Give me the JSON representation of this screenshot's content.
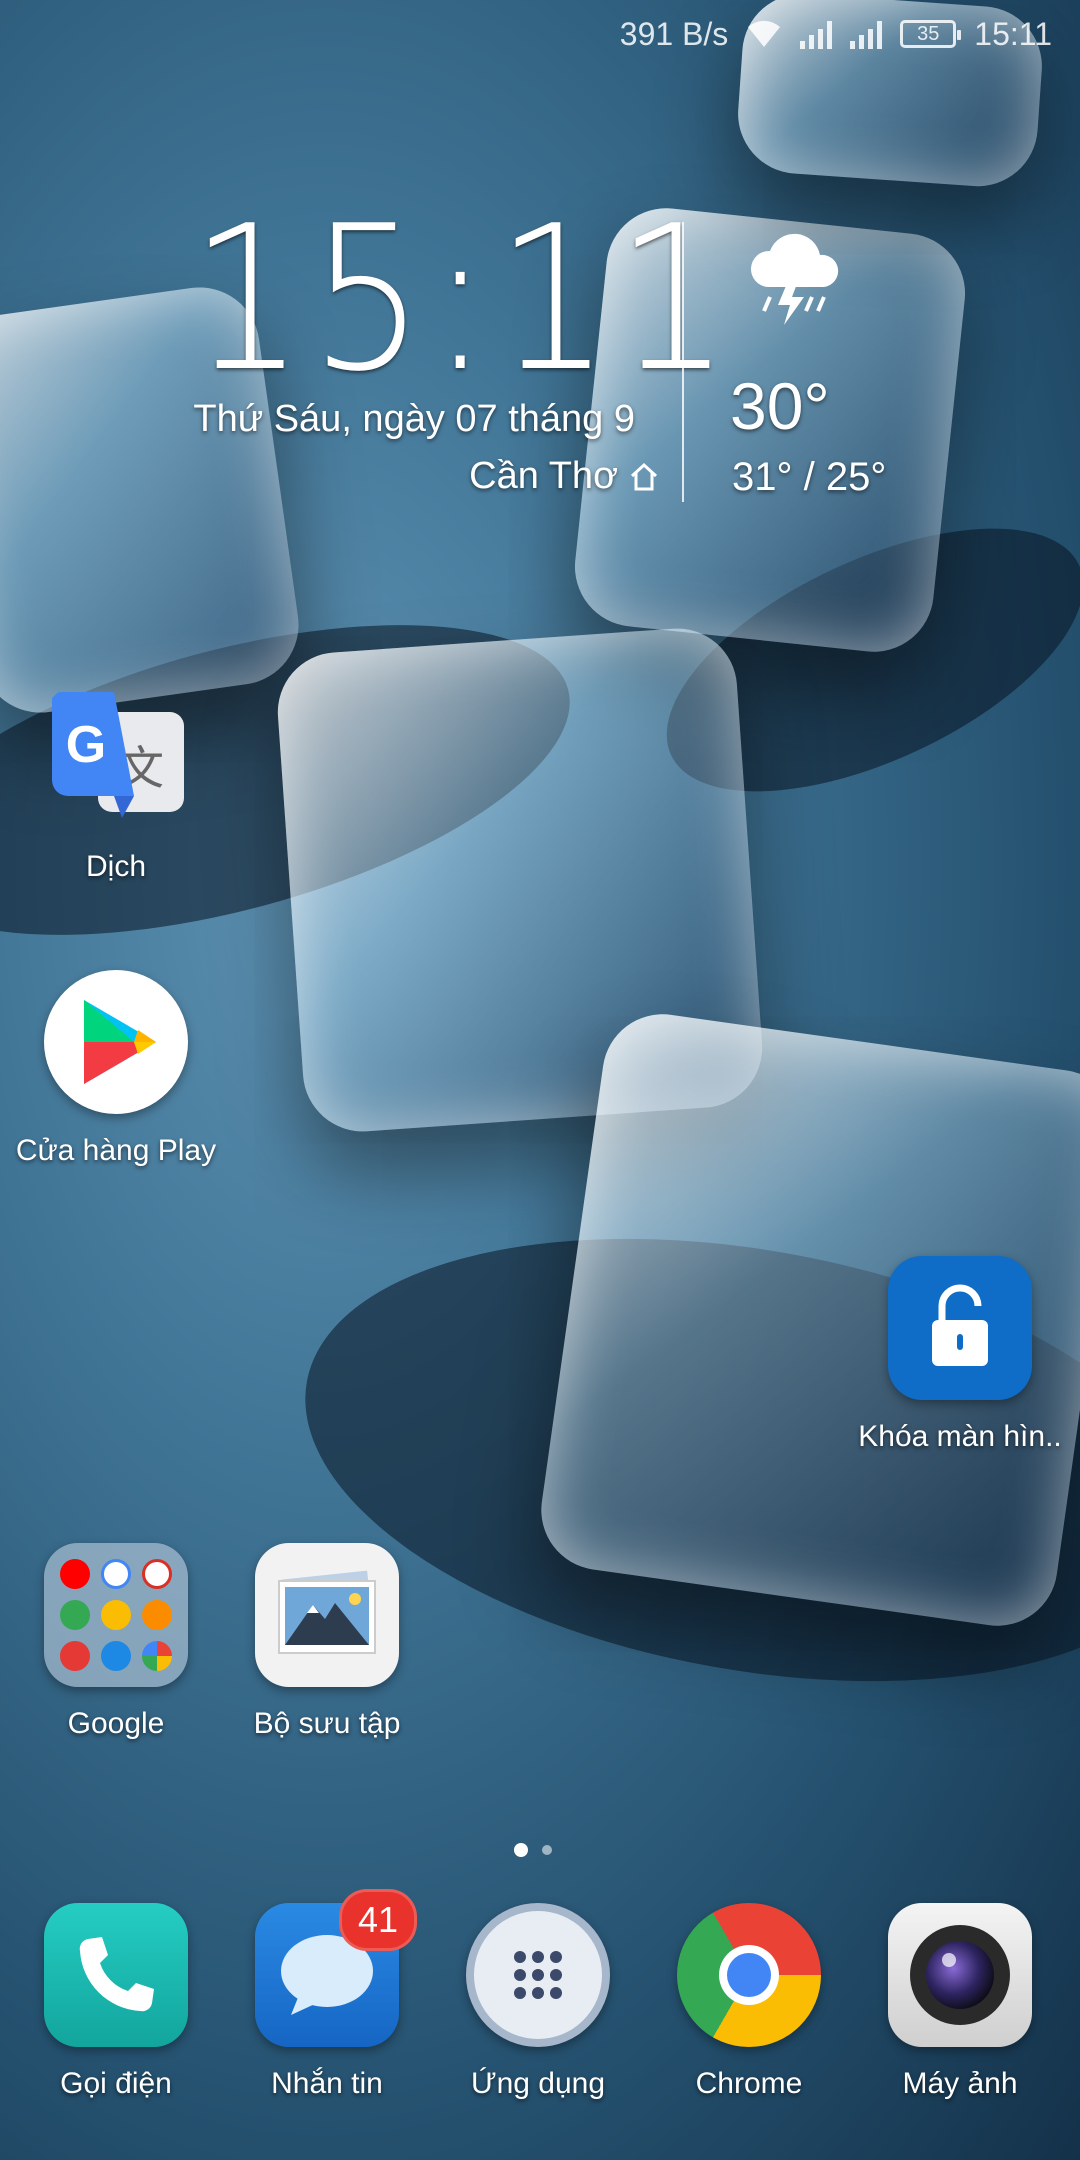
{
  "status_bar": {
    "net_speed": "391 B/s",
    "battery": "35",
    "time": "15:11",
    "icons": [
      "wifi-icon",
      "signal-icon",
      "signal-icon",
      "battery-icon"
    ]
  },
  "clock_widget": {
    "time": "15:11",
    "date": "Thứ Sáu, ngày 07 tháng 9",
    "city": "Cần Thơ",
    "weather_icon": "thunderstorm-icon",
    "temperature": "30°",
    "range": "31° / 25°"
  },
  "apps": {
    "translate": "Dịch",
    "play_store": "Cửa hàng Play",
    "lock_screen": "Khóa màn hìn..",
    "google_folder": "Google",
    "gallery": "Bộ sưu tập"
  },
  "pager": {
    "pages": 2,
    "current": 1
  },
  "dock": {
    "phone": "Gọi điện",
    "messages": "Nhắn tin",
    "messages_badge": "41",
    "apps": "Ứng dụng",
    "chrome": "Chrome",
    "camera": "Máy ảnh"
  },
  "colors": {
    "badge": "#e8322b",
    "phone_teal": "#1bb9b0",
    "messages_blue": "#1f7fd6",
    "lock_blue": "#0f6cc7"
  }
}
